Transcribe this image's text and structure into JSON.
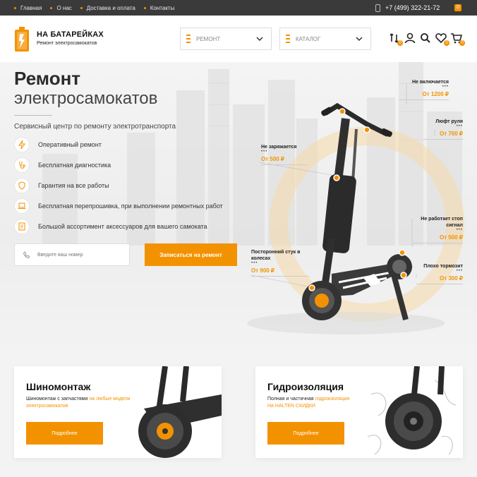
{
  "topbar": {
    "nav": [
      "Главная",
      "О нас",
      "Доставка и оплата",
      "Контакты"
    ],
    "phone": "+7 (499) 322-21-72",
    "badge": "0"
  },
  "header": {
    "logo_title": "НА БАТАРЕЙКАХ",
    "logo_sub": "Ремонт электросамокатов",
    "menu_repair": "РЕМОНТ",
    "menu_catalog": "КАТАЛОГ",
    "icons": [
      "compare-icon",
      "user-icon",
      "search-icon",
      "heart-icon",
      "cart-icon"
    ],
    "counts": {
      "compare": "0",
      "favorites": "0",
      "cart": "0"
    }
  },
  "hero": {
    "title_line1": "Ремонт",
    "title_line2": "электросамокатов",
    "subtitle": "Сервисный центр по ремонту электротранспорта",
    "features": [
      {
        "icon": "lightning-icon",
        "label": "Оперативный ремонт"
      },
      {
        "icon": "stethoscope-icon",
        "label": "Бесплатная диагностика"
      },
      {
        "icon": "shield-icon",
        "label": "Гарантия на все работы"
      },
      {
        "icon": "laptop-icon",
        "label": "Бесплатная перепрошивка, при выполнении ремонтных работ"
      },
      {
        "icon": "accessories-icon",
        "label": "Большой ассортимент аксессуаров для вашего самоката"
      }
    ],
    "phone_placeholder": "Введите ваш номер",
    "cta_label": "Записаться на ремонт"
  },
  "repairs": {
    "no_power": {
      "title": "Не включается",
      "price": "От 1200 ₽"
    },
    "steering": {
      "title": "Люфт руля",
      "price": "От 700 ₽"
    },
    "no_charge": {
      "title": "Не заряжается",
      "price": "От 500 ₽"
    },
    "stop_signal": {
      "title": "Не работает стоп сигнал",
      "price": "От 500 ₽"
    },
    "wheel_knock": {
      "title": "Посторонний стук в колесах",
      "price": "От 900 ₽"
    },
    "brakes": {
      "title": "Плохо тормозит",
      "price": "От 300 ₽"
    }
  },
  "cards": [
    {
      "title": "Шиномонтаж",
      "desc_plain": "Шиномонтаж с запчастями",
      "desc_hl": "на любые модели электросамокатов",
      "button": "Подробнее"
    },
    {
      "title": "Гидроизоляция",
      "desc_plain": "Полная и частичная",
      "desc_hl": "гидроизоляция",
      "desc_line2": "На HALTEN СКИДКИ",
      "button": "Подробнее"
    }
  ],
  "colors": {
    "accent": "#f39200",
    "topbar": "#3a3a3a"
  }
}
